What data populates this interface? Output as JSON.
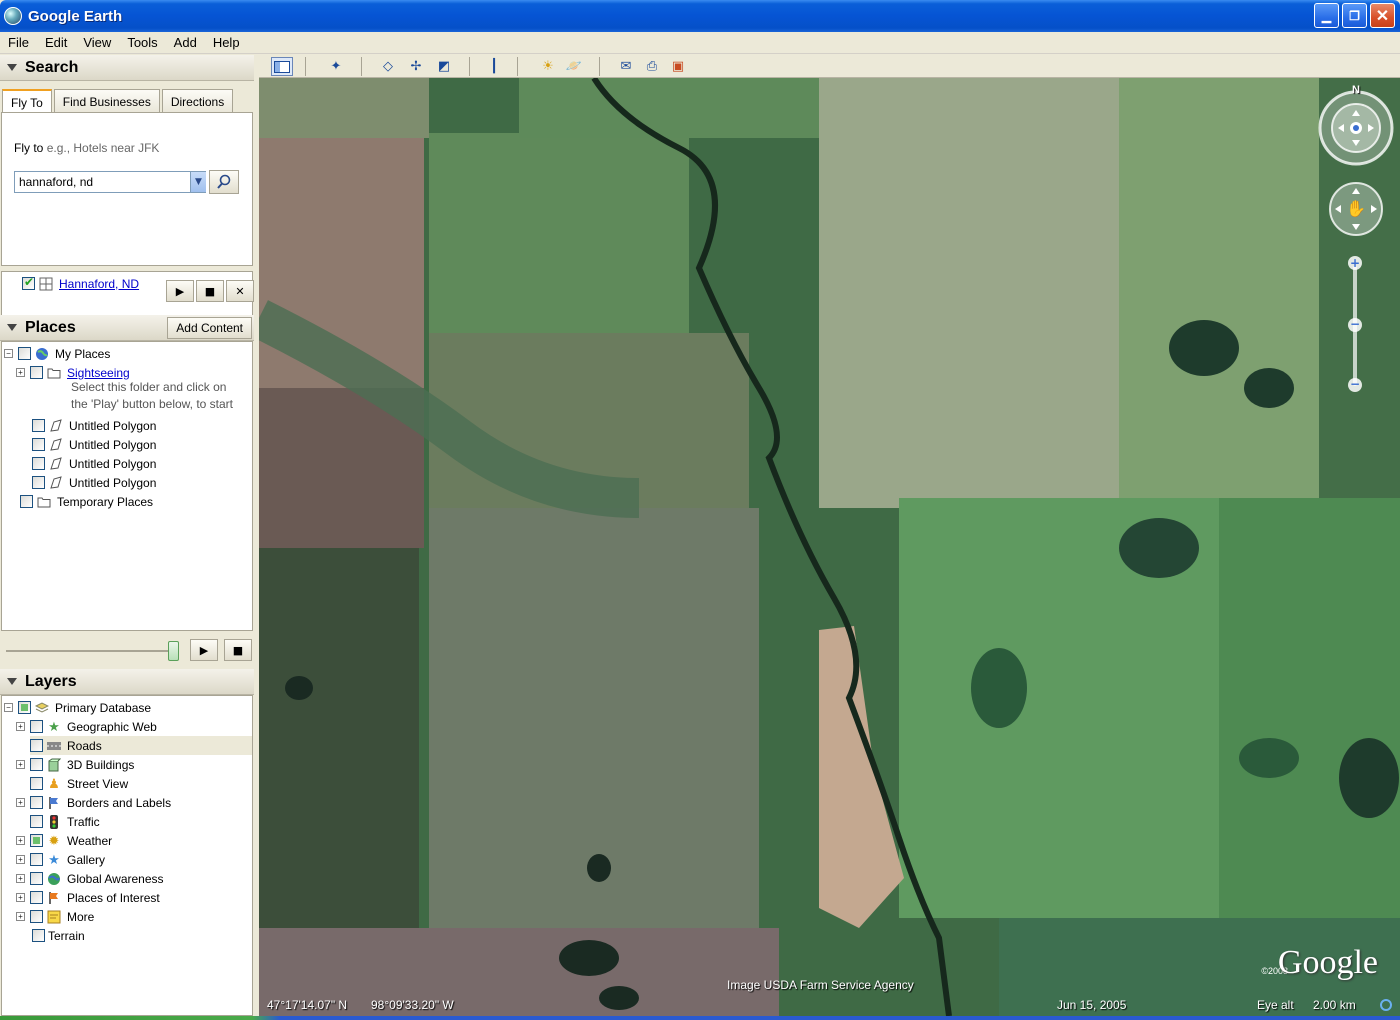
{
  "window": {
    "title": "Google Earth"
  },
  "menu": [
    "File",
    "Edit",
    "View",
    "Tools",
    "Add",
    "Help"
  ],
  "search": {
    "title": "Search",
    "tabs": [
      "Fly To",
      "Find Businesses",
      "Directions"
    ],
    "flyto_label": "Fly to",
    "flyto_hint": "e.g., Hotels near JFK",
    "query": "hannaford, nd",
    "result": "Hannaford, ND"
  },
  "places": {
    "title": "Places",
    "add_content": "Add Content",
    "items": {
      "my_places": "My Places",
      "sightseeing": "Sightseeing",
      "sightseeing_desc_1": "Select this folder and click on",
      "sightseeing_desc_2": "the 'Play' button below, to start",
      "polygon": "Untitled Polygon",
      "temporary": "Temporary Places"
    }
  },
  "layers": {
    "title": "Layers",
    "primary": "Primary Database",
    "items": [
      "Geographic Web",
      "Roads",
      "3D Buildings",
      "Street View",
      "Borders and Labels",
      "Traffic",
      "Weather",
      "Gallery",
      "Global Awareness",
      "Places of Interest",
      "More"
    ],
    "terrain": "Terrain"
  },
  "map": {
    "credit": "Image USDA Farm Service Agency",
    "logo": "Google",
    "logo_year": "©2008",
    "lat": "47°17'14.07\" N",
    "lon": "98°09'33.20\" W",
    "date": "Jun 15, 2005",
    "eye_alt_label": "Eye alt",
    "eye_alt": "2.00 km",
    "compass_n": "N"
  }
}
